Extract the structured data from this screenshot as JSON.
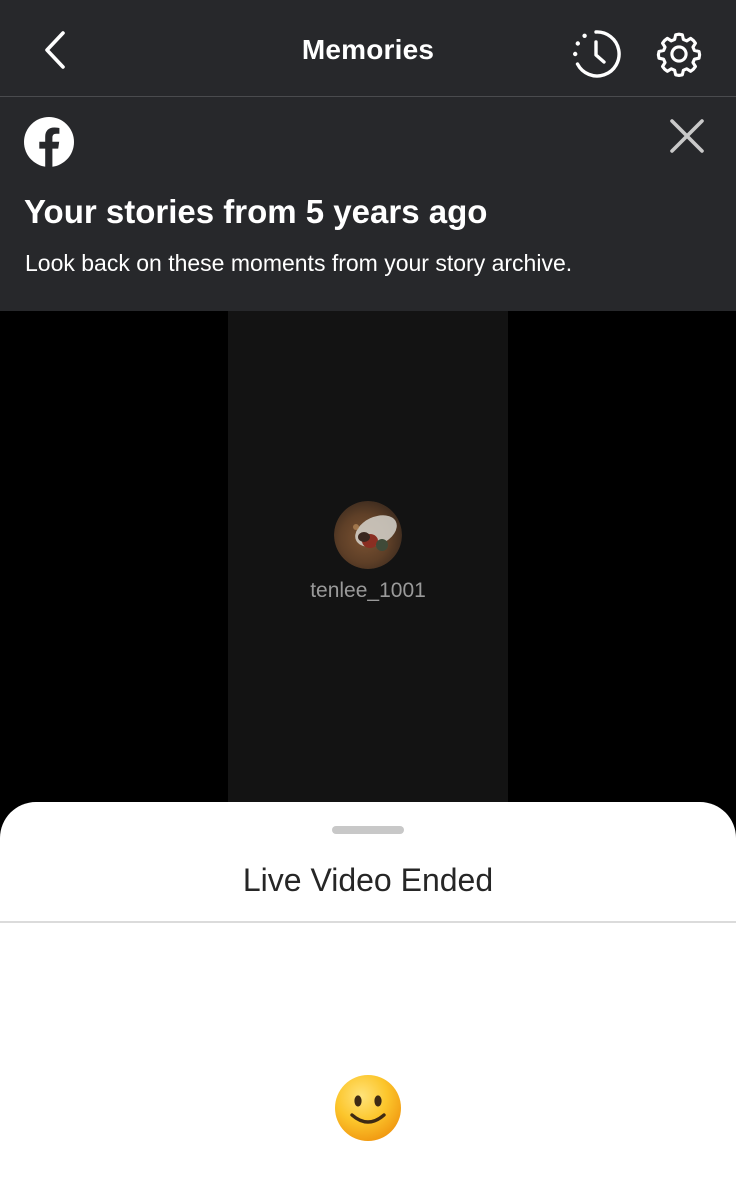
{
  "header": {
    "title": "Memories",
    "back_icon": "chevron-left-icon",
    "history_icon": "history-clock-icon",
    "settings_icon": "gear-icon",
    "background": "#27282b"
  },
  "banner": {
    "logo_icon": "facebook-logo-icon",
    "close_icon": "close-icon",
    "title": "Your stories from 5 years ago",
    "subtitle": "Look back on these moments from your story archive."
  },
  "story": {
    "username": "tenlee_1001",
    "avatar_icon": "profile-avatar"
  },
  "sheet": {
    "title": "Live Video Ended",
    "emoji_icon": "smiling-face-emoji"
  }
}
